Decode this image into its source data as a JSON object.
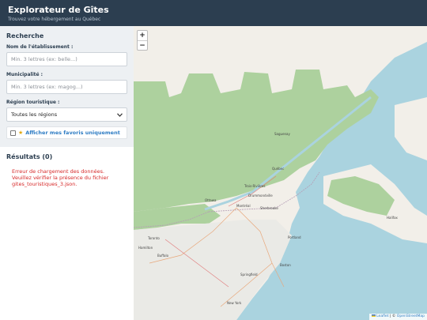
{
  "header": {
    "title": "Explorateur de Gîtes",
    "subtitle": "Trouvez votre hébergement au Québec"
  },
  "search": {
    "title": "Recherche",
    "name_label": "Nom de l'établissement :",
    "name_placeholder": "Min. 3 lettres (ex: belle...)",
    "name_value": "",
    "city_label": "Municipalité :",
    "city_placeholder": "Min. 3 lettres (ex: magog...)",
    "city_value": "",
    "region_label": "Région touristique :",
    "region_selected": "Toutes les régions",
    "favorites_label": "Afficher mes favoris uniquement"
  },
  "results": {
    "title": "Résultats (0)",
    "error": "Erreur de chargement des données. Veuillez vérifier la présence du fichier gites_touristiques_3.json."
  },
  "map": {
    "zoom_in": "+",
    "zoom_out": "−",
    "attribution_leaflet": "Leaflet",
    "attribution_sep": "|",
    "attribution_osm": "OpenStreetMap",
    "places": {
      "saguenay": "Saguenay",
      "quebec": "Québec",
      "trois_rivieres": "Trois-Rivières",
      "drummondville": "Drummondville",
      "ottawa": "Ottawa",
      "montreal": "Montréal",
      "sherbrooke": "Sherbrooke",
      "toronto": "Toronto",
      "hamilton": "Hamilton",
      "buffalo": "Buffalo",
      "portland": "Portland",
      "boston": "Boston",
      "springfield": "Springfield",
      "new_york": "New York",
      "halifax": "Halifax"
    }
  },
  "colors": {
    "header_bg": "#2c3e50",
    "panel_bg": "#edf0f3",
    "accent": "#2f7dc4",
    "error": "#d62828",
    "water": "#aad3df",
    "land": "#f2efe9",
    "forest": "#add19e"
  }
}
